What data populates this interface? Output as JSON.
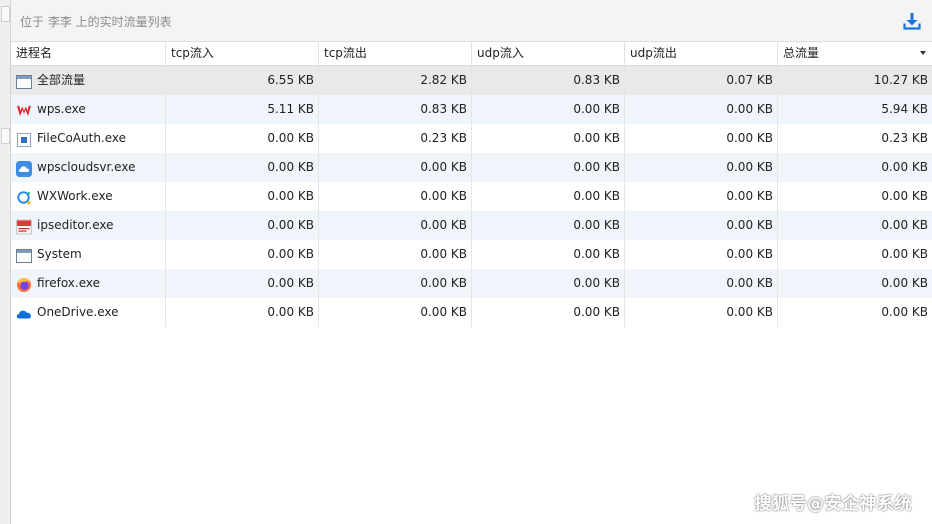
{
  "window": {
    "title": "位于 李李 上的实时流量列表",
    "download_icon": "download-icon"
  },
  "table": {
    "columns": [
      "进程名",
      "tcp流入",
      "tcp流出",
      "udp流入",
      "udp流出",
      "总流量"
    ],
    "sorted_column": "总流量",
    "rows": [
      {
        "icon": "window-icon",
        "name": "全部流量",
        "tcp_in": "6.55 KB",
        "tcp_out": "2.82 KB",
        "udp_in": "0.83 KB",
        "udp_out": "0.07 KB",
        "total": "10.27 KB"
      },
      {
        "icon": "wps-icon",
        "name": "wps.exe",
        "tcp_in": "5.11 KB",
        "tcp_out": "0.83 KB",
        "udp_in": "0.00 KB",
        "udp_out": "0.00 KB",
        "total": "5.94 KB"
      },
      {
        "icon": "filecoauth-icon",
        "name": "FileCoAuth.exe",
        "tcp_in": "0.00 KB",
        "tcp_out": "0.23 KB",
        "udp_in": "0.00 KB",
        "udp_out": "0.00 KB",
        "total": "0.23 KB"
      },
      {
        "icon": "wps-cloud-icon",
        "name": "wpscloudsvr.exe",
        "tcp_in": "0.00 KB",
        "tcp_out": "0.00 KB",
        "udp_in": "0.00 KB",
        "udp_out": "0.00 KB",
        "total": "0.00 KB"
      },
      {
        "icon": "wxwork-icon",
        "name": "WXWork.exe",
        "tcp_in": "0.00 KB",
        "tcp_out": "0.00 KB",
        "udp_in": "0.00 KB",
        "udp_out": "0.00 KB",
        "total": "0.00 KB"
      },
      {
        "icon": "ipseditor-icon",
        "name": "ipseditor.exe",
        "tcp_in": "0.00 KB",
        "tcp_out": "0.00 KB",
        "udp_in": "0.00 KB",
        "udp_out": "0.00 KB",
        "total": "0.00 KB"
      },
      {
        "icon": "window-icon",
        "name": "System",
        "tcp_in": "0.00 KB",
        "tcp_out": "0.00 KB",
        "udp_in": "0.00 KB",
        "udp_out": "0.00 KB",
        "total": "0.00 KB"
      },
      {
        "icon": "firefox-icon",
        "name": "firefox.exe",
        "tcp_in": "0.00 KB",
        "tcp_out": "0.00 KB",
        "udp_in": "0.00 KB",
        "udp_out": "0.00 KB",
        "total": "0.00 KB"
      },
      {
        "icon": "onedrive-icon",
        "name": "OneDrive.exe",
        "tcp_in": "0.00 KB",
        "tcp_out": "0.00 KB",
        "udp_in": "0.00 KB",
        "udp_out": "0.00 KB",
        "total": "0.00 KB"
      }
    ]
  },
  "watermark": "搜狐号@安企神系统",
  "colors": {
    "accent": "#1a73d9",
    "row_alt": "#f0f4fb",
    "row_total": "#e9e9e9"
  }
}
